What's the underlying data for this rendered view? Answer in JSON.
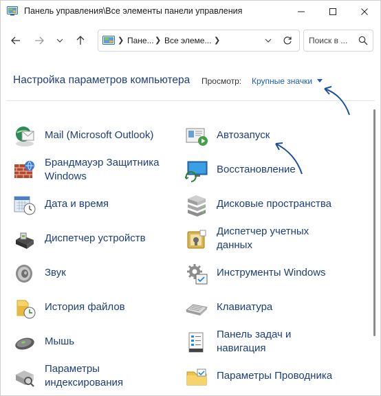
{
  "window": {
    "title": "Панель управления\\Все элементы панели управления"
  },
  "address": {
    "crumbs": [
      "Пане...",
      "Все элеме..."
    ]
  },
  "search": {
    "placeholder": "Поиск в ..."
  },
  "header": {
    "title": "Настройка параметров компьютера",
    "view_label": "Просмотр:",
    "view_value": "Крупные значки"
  },
  "items_left": [
    {
      "label": "Mail (Microsoft Outlook)",
      "icon": "mail-icon"
    },
    {
      "label": "Брандмауэр Защитника\nWindows",
      "icon": "firewall-icon"
    },
    {
      "label": "Дата и время",
      "icon": "datetime-icon"
    },
    {
      "label": "Диспетчер устройств",
      "icon": "device-manager-icon"
    },
    {
      "label": "Звук",
      "icon": "sound-icon"
    },
    {
      "label": "История файлов",
      "icon": "file-history-icon"
    },
    {
      "label": "Мышь",
      "icon": "mouse-icon"
    },
    {
      "label": "Параметры\nиндексирования",
      "icon": "indexing-icon"
    }
  ],
  "items_right": [
    {
      "label": "Автозапуск",
      "icon": "autoplay-icon"
    },
    {
      "label": "Восстановление",
      "icon": "recovery-icon"
    },
    {
      "label": "Дисковые пространства",
      "icon": "storage-spaces-icon"
    },
    {
      "label": "Диспетчер учетных\nданных",
      "icon": "credential-manager-icon"
    },
    {
      "label": "Инструменты Windows",
      "icon": "windows-tools-icon"
    },
    {
      "label": "Клавиатура",
      "icon": "keyboard-icon"
    },
    {
      "label": "Панель задач и\nнавигация",
      "icon": "taskbar-icon"
    },
    {
      "label": "Параметры Проводника",
      "icon": "explorer-options-icon"
    }
  ],
  "colors": {
    "link": "#1b3f78",
    "accent": "#1d5bb3",
    "annotation_arrow": "#1f4fa0"
  }
}
